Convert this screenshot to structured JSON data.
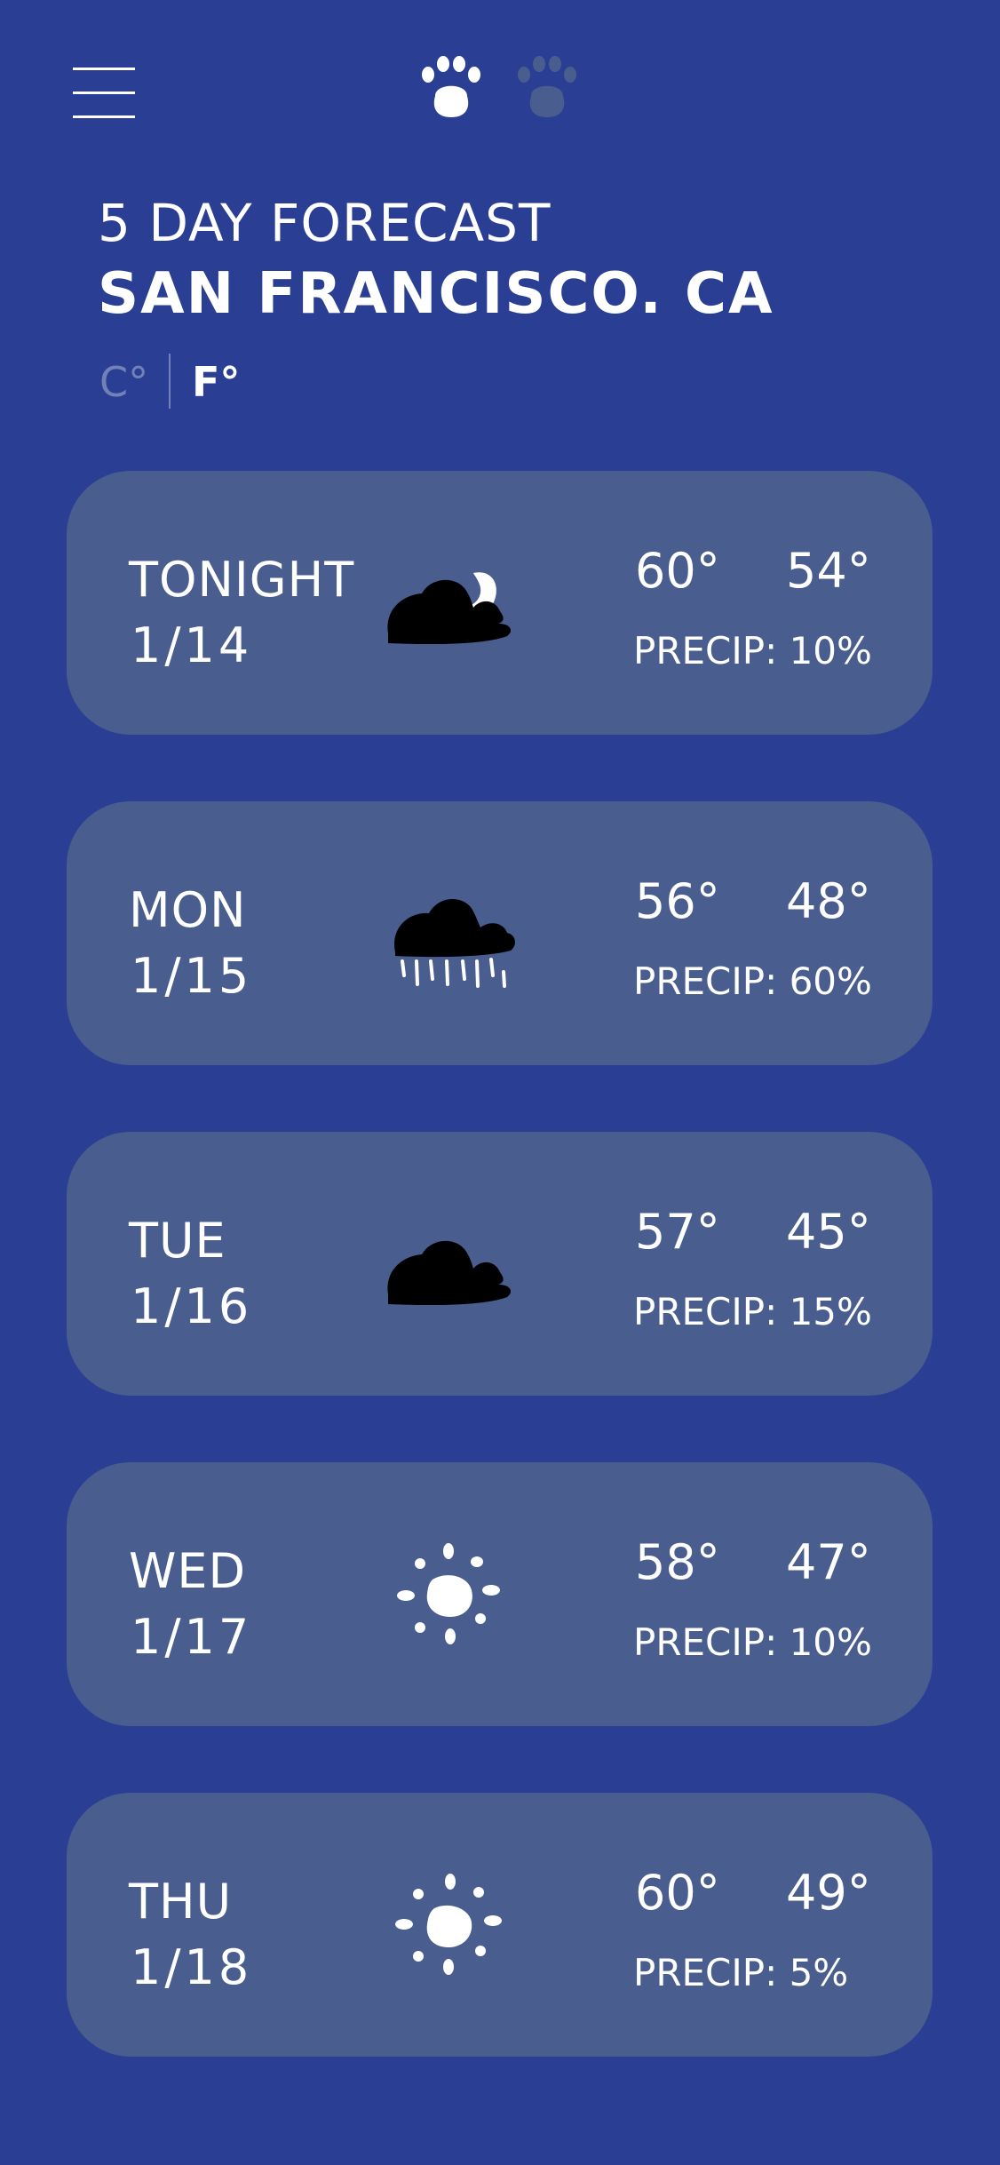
{
  "header": {
    "menu_icon": "hamburger-menu-icon",
    "pager_icons": [
      "paw-icon",
      "paw-icon"
    ],
    "pager_active_index": 0,
    "subtitle": "5 DAY FORECAST",
    "city": "SAN FRANCISCO. CA"
  },
  "units": {
    "celsius": "C°",
    "fahrenheit": "F°",
    "selected": "F°"
  },
  "colors": {
    "background": "#2a3f94",
    "card": "#4a5d8f",
    "text": "#ffffff",
    "inactive": "#7282b8",
    "icon_cloud": "#000000",
    "icon_sun": "#ffffff"
  },
  "forecast": [
    {
      "day": "TONIGHT",
      "date": "1/14",
      "icon": "partly-cloudy-night-icon",
      "high": "60°",
      "low": "54°",
      "precip": "PRECIP: 10%"
    },
    {
      "day": "MON",
      "date": "1/15",
      "icon": "rain-cloud-icon",
      "high": "56°",
      "low": "48°",
      "precip": "PRECIP: 60%"
    },
    {
      "day": "TUE",
      "date": "1/16",
      "icon": "cloud-icon",
      "high": "57°",
      "low": "45°",
      "precip": "PRECIP: 15%"
    },
    {
      "day": "WED",
      "date": "1/17",
      "icon": "sun-icon",
      "high": "58°",
      "low": "47°",
      "precip": "PRECIP: 10%"
    },
    {
      "day": "THU",
      "date": "1/18",
      "icon": "sun-icon",
      "high": "60°",
      "low": "49°",
      "precip": "PRECIP: 5%"
    }
  ]
}
